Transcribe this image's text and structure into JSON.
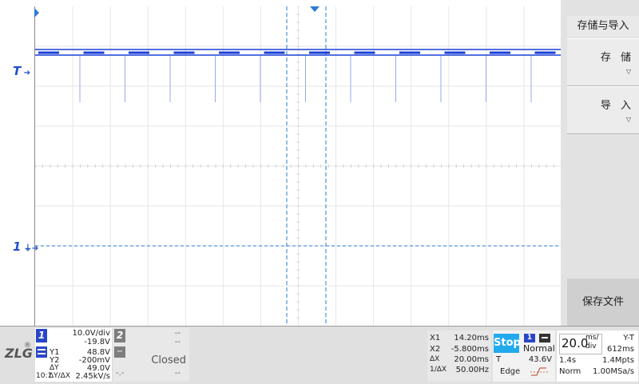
{
  "markers": {
    "trigger_label": "T",
    "ch1_label": "1"
  },
  "menu": {
    "title": "存储与导入",
    "save_label": "存 储",
    "load_label": "导 入",
    "save_file_label": "保存文件"
  },
  "brand": {
    "logo_text": "ZLG",
    "registered": "®"
  },
  "ch1": {
    "number": "1",
    "scale": "10.0V/div",
    "offset": "-19.8V",
    "y1_label": "Y1",
    "y1": "48.8V",
    "y2_label": "Y2",
    "y2": "-200mV",
    "dy_label": "ΔY",
    "dy": "49.0V",
    "probe": "10:1",
    "rate_label": "ΔY/ΔX",
    "rate": "2.45kV/s"
  },
  "ch2": {
    "number": "2",
    "line1": "--",
    "line2": "--",
    "status": "Closed",
    "line3": "--",
    "minus": "−",
    "dash": "-.-"
  },
  "cursor": {
    "x1_label": "X1",
    "x1": "14.20ms",
    "x2_label": "X2",
    "x2": "-5.800ms",
    "dx_label": "ΔX",
    "dx": "20.00ms",
    "inv_label": "1/ΔX",
    "inv": "50.00Hz"
  },
  "run": {
    "state": "Stop",
    "trig_ch": "1",
    "mode": "Normal",
    "level_label": "T",
    "level": "43.6V",
    "type": "Edge"
  },
  "timebase": {
    "value": "20.0",
    "unit_top": "ms/",
    "unit_bottom": "div",
    "mode": "Y-T",
    "delay": "612ms",
    "span": "1.4s",
    "mem": "1.4Mpts",
    "acq": "Norm",
    "rate": "1.00MSa/s"
  },
  "colors": {
    "trace": "#1a3fd6",
    "cursor": "#2a7bd6",
    "run": "#22aaee",
    "ch1": "#2a46c8",
    "ch2": "#7d7d7d"
  }
}
